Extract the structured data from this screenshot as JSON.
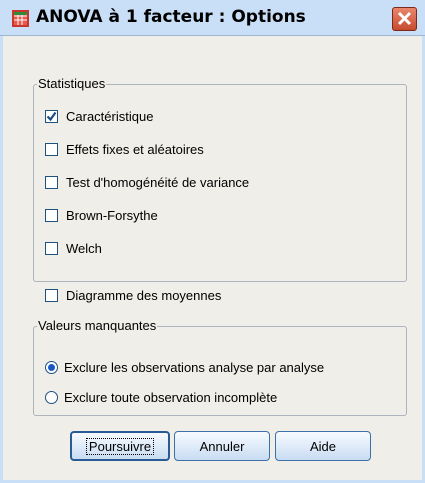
{
  "window": {
    "title": "ANOVA à 1 facteur : Options"
  },
  "statistics_group": {
    "legend": "Statistiques",
    "items": [
      {
        "label": "Caractéristique",
        "checked": true
      },
      {
        "label": "Effets fixes et aléatoires",
        "checked": false
      },
      {
        "label": "Test d'homogénéité de variance",
        "checked": false
      },
      {
        "label": "Brown-Forsythe",
        "checked": false
      },
      {
        "label": "Welch",
        "checked": false
      }
    ]
  },
  "means_plot": {
    "label": "Diagramme des moyennes",
    "checked": false
  },
  "missing_group": {
    "legend": "Valeurs manquantes",
    "options": [
      {
        "label": "Exclure les observations analyse par analyse",
        "selected": true
      },
      {
        "label": "Exclure toute observation incomplète",
        "selected": false
      }
    ]
  },
  "buttons": {
    "continue": "Poursuivre",
    "cancel": "Annuler",
    "help": "Aide"
  },
  "icons": {
    "app": "spss-grid-icon",
    "close": "close-icon",
    "check": "checkmark-icon"
  },
  "colors": {
    "titlebar": "#c9dff7",
    "close_button": "#d45a3c",
    "radio_dot": "#1b57c4",
    "checkmark": "#1c4b82"
  }
}
